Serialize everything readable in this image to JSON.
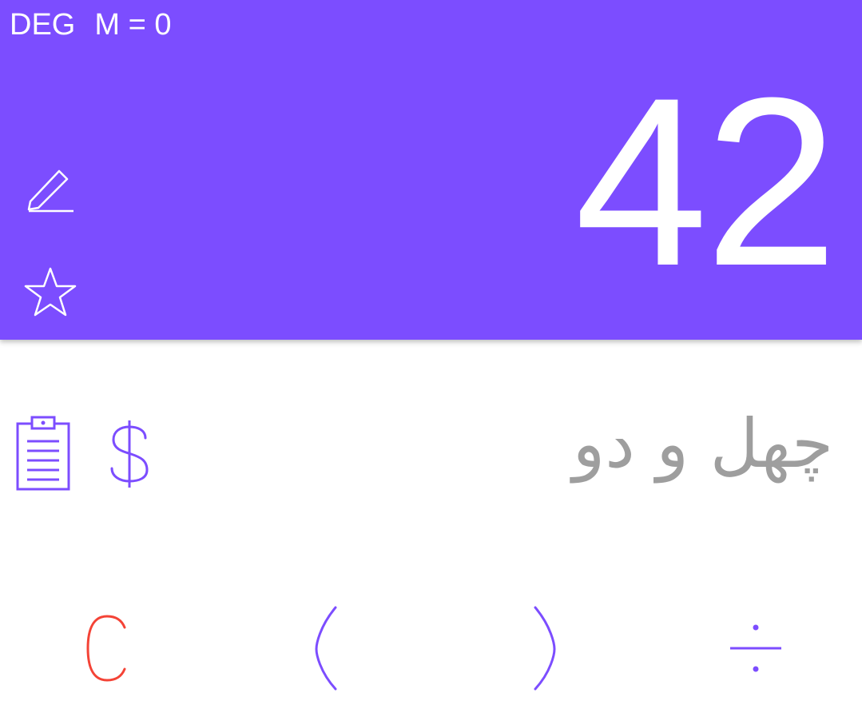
{
  "status": {
    "angle_mode": "DEG",
    "memory": "M = 0"
  },
  "display": {
    "result": "42"
  },
  "words": {
    "text": "چهل و دو"
  },
  "colors": {
    "accent": "#7c4dff",
    "clear_key": "#f44336",
    "words_text": "#9e9e9e",
    "on_accent": "#ffffff"
  },
  "icons": {
    "edit": "pencil-icon",
    "favorite": "star-icon",
    "clipboard": "clipboard-icon",
    "currency": "dollar-icon"
  },
  "keys": [
    {
      "label": "C",
      "icon": "clear-icon"
    },
    {
      "label": "(",
      "icon": "open-paren-icon"
    },
    {
      "label": ")",
      "icon": "close-paren-icon"
    },
    {
      "label": "÷",
      "icon": "divide-icon"
    }
  ]
}
